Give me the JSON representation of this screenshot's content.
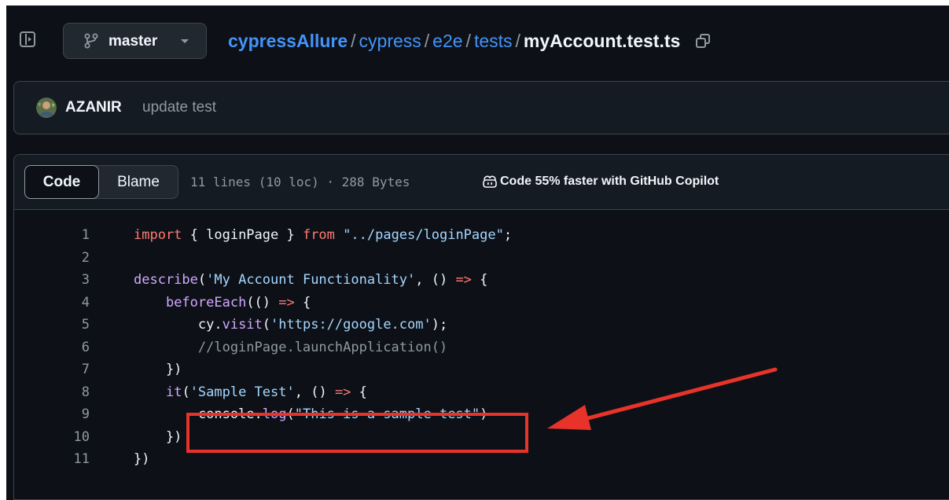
{
  "header": {
    "branch": "master",
    "breadcrumb": {
      "repo": "cypressAllure",
      "dirs": [
        "cypress",
        "e2e",
        "tests"
      ],
      "file": "myAccount.test.ts",
      "separator": "/"
    },
    "icons": {
      "sidebar_toggle": "sidebar-expand-icon",
      "branch": "git-branch-icon",
      "caret": "triangle-down-icon",
      "copy": "copy-icon"
    }
  },
  "commit": {
    "author": "AZANIR",
    "message": "update test",
    "icon": "avatar"
  },
  "code_view": {
    "tabs": [
      {
        "label": "Code",
        "selected": true
      },
      {
        "label": "Blame",
        "selected": false
      }
    ],
    "file_info": "11 lines (10 loc) · 288 Bytes",
    "copilot": {
      "icon": "copilot-icon",
      "text": "Code 55% faster with GitHub Copilot"
    },
    "lines": [
      {
        "num": "1",
        "tokens": [
          {
            "t": "import",
            "k": "keyword"
          },
          {
            "t": " { loginPage } ",
            "k": "plain"
          },
          {
            "t": "from",
            "k": "keyword"
          },
          {
            "t": " ",
            "k": "plain"
          },
          {
            "t": "\"../pages/loginPage\"",
            "k": "str"
          },
          {
            "t": ";",
            "k": "plain"
          }
        ]
      },
      {
        "num": "2",
        "tokens": []
      },
      {
        "num": "3",
        "tokens": [
          {
            "t": "describe",
            "k": "fn"
          },
          {
            "t": "(",
            "k": "plain"
          },
          {
            "t": "'My Account Functionality'",
            "k": "str"
          },
          {
            "t": ", () ",
            "k": "plain"
          },
          {
            "t": "=>",
            "k": "keyword"
          },
          {
            "t": " {",
            "k": "plain"
          }
        ]
      },
      {
        "num": "4",
        "tokens": [
          {
            "t": "    ",
            "k": "plain"
          },
          {
            "t": "beforeEach",
            "k": "fn"
          },
          {
            "t": "(() ",
            "k": "plain"
          },
          {
            "t": "=>",
            "k": "keyword"
          },
          {
            "t": " {",
            "k": "plain"
          }
        ]
      },
      {
        "num": "5",
        "tokens": [
          {
            "t": "        cy.",
            "k": "plain"
          },
          {
            "t": "visit",
            "k": "fn"
          },
          {
            "t": "(",
            "k": "plain"
          },
          {
            "t": "'https://google.com'",
            "k": "str"
          },
          {
            "t": ");",
            "k": "plain"
          }
        ]
      },
      {
        "num": "6",
        "tokens": [
          {
            "t": "        //loginPage.launchApplication()",
            "k": "comment"
          }
        ]
      },
      {
        "num": "7",
        "tokens": [
          {
            "t": "    })",
            "k": "plain"
          }
        ]
      },
      {
        "num": "8",
        "tokens": [
          {
            "t": "    ",
            "k": "plain"
          },
          {
            "t": "it",
            "k": "fn"
          },
          {
            "t": "(",
            "k": "plain"
          },
          {
            "t": "'Sample Test'",
            "k": "str"
          },
          {
            "t": ", () ",
            "k": "plain"
          },
          {
            "t": "=>",
            "k": "keyword"
          },
          {
            "t": " {",
            "k": "plain"
          }
        ]
      },
      {
        "num": "9",
        "tokens": [
          {
            "t": "        console.",
            "k": "plain"
          },
          {
            "t": "log",
            "k": "fn"
          },
          {
            "t": "(",
            "k": "plain"
          },
          {
            "t": "\"This is a sample test\"",
            "k": "str"
          },
          {
            "t": ")",
            "k": "plain"
          }
        ]
      },
      {
        "num": "10",
        "tokens": [
          {
            "t": "    })",
            "k": "plain"
          }
        ]
      },
      {
        "num": "11",
        "tokens": [
          {
            "t": "})",
            "k": "plain"
          }
        ]
      }
    ]
  },
  "annotation": {
    "color": "#e8332a",
    "highlight": "red-box-around-line-9",
    "arrow": "red-arrow-pointing-left"
  },
  "colors": {
    "background": "#0d1117",
    "keyword": "#ff7b72",
    "function": "#d2a8ff",
    "string": "#a5d6ff",
    "link": "#4493f8"
  }
}
